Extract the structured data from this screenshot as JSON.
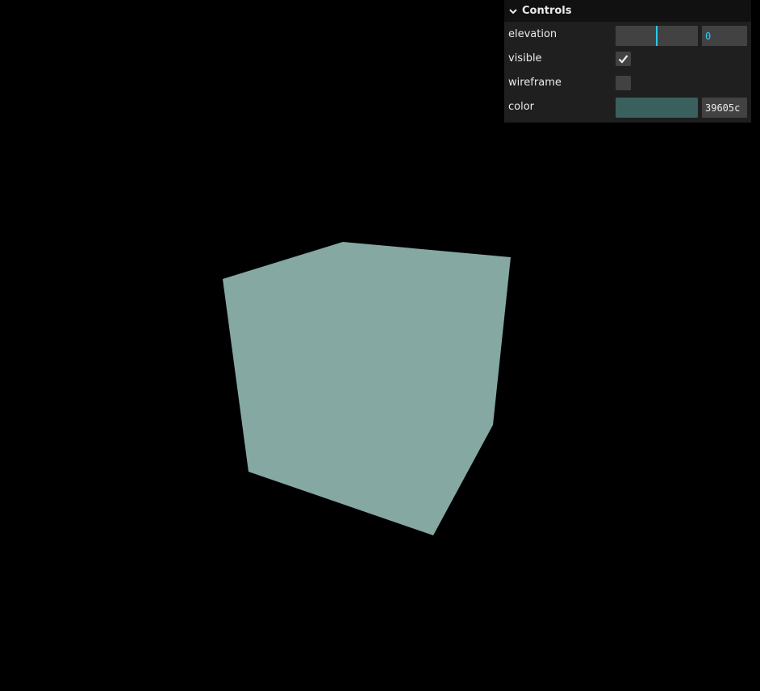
{
  "scene": {
    "background_color": "#000000",
    "cube_color": "#85a8a3",
    "object": "cube"
  },
  "gui": {
    "title": "Controls",
    "accent_color": "#2cc9ff",
    "elevation": {
      "label": "elevation",
      "value": "0",
      "slider_fraction": 0.5
    },
    "visible": {
      "label": "visible",
      "checked": true
    },
    "wireframe": {
      "label": "wireframe",
      "checked": false
    },
    "color": {
      "label": "color",
      "value": "39605c",
      "swatch": "#39605c"
    }
  }
}
